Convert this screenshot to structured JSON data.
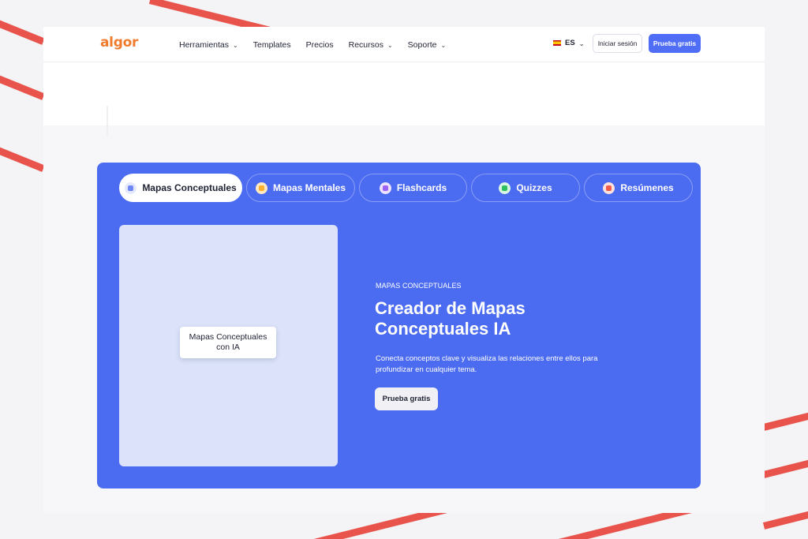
{
  "nav": {
    "logo": "algor",
    "items": [
      {
        "label": "Herramientas",
        "dropdown": true
      },
      {
        "label": "Templates",
        "dropdown": false
      },
      {
        "label": "Precios",
        "dropdown": false
      },
      {
        "label": "Recursos",
        "dropdown": true
      },
      {
        "label": "Soporte",
        "dropdown": true
      }
    ],
    "language": "ES",
    "login_label": "Iniciar sesión",
    "trial_label": "Prueba gratis"
  },
  "tabs": [
    {
      "label": "Mapas Conceptuales",
      "icon": "concept-map-icon",
      "color": "#8fa3ff",
      "active": true
    },
    {
      "label": "Mapas Mentales",
      "icon": "mind-map-icon",
      "color": "#ffc25a",
      "active": false
    },
    {
      "label": "Flashcards",
      "icon": "flashcards-icon",
      "color": "#b68cff",
      "active": false
    },
    {
      "label": "Quizzes",
      "icon": "quizzes-icon",
      "color": "#47d17a",
      "active": false
    },
    {
      "label": "Resúmenes",
      "icon": "summaries-icon",
      "color": "#ff7a6b",
      "active": false
    }
  ],
  "hero": {
    "image_label": "Mapas Conceptuales con IA",
    "kicker": "MAPAS CONCEPTUALES",
    "headline": "Creador de Mapas Conceptuales IA",
    "description": "Conecta conceptos clave y visualiza las relaciones entre ellos para profundizar en cualquier tema.",
    "cta_label": "Prueba gratis"
  },
  "colors": {
    "accent": "#4b6bf0",
    "logo": "#f07b2d",
    "stripe": "#e8544c"
  }
}
